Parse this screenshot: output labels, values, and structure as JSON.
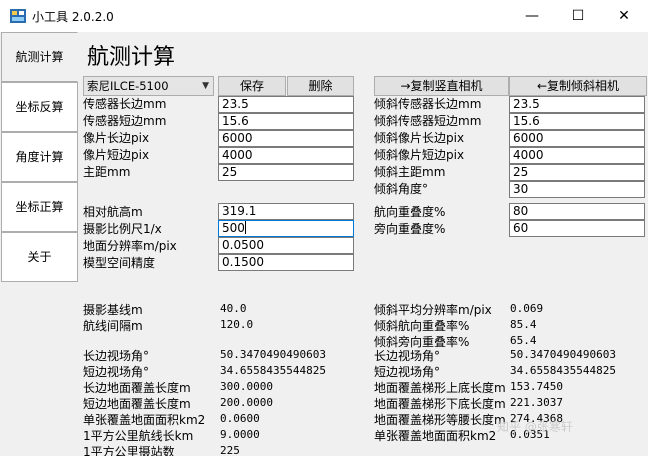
{
  "window": {
    "title": "小工具  2.0.2.0",
    "minimize_glyph": "—",
    "maximize_glyph": "☐",
    "close_glyph": "✕"
  },
  "nav": {
    "items": [
      {
        "label": "航测计算",
        "active": true
      },
      {
        "label": "坐标反算",
        "active": false
      },
      {
        "label": "角度计算",
        "active": false
      },
      {
        "label": "坐标正算",
        "active": false
      },
      {
        "label": "关于",
        "active": false
      }
    ]
  },
  "page": {
    "title": "航测计算",
    "camera_select": {
      "value": "索尼ILCE-5100"
    },
    "save_label": "保存",
    "delete_label": "删除",
    "copy_vertical_label": "→复制竖直相机",
    "copy_oblique_label": "←复制倾斜相机"
  },
  "vertical_camera": [
    {
      "label": "传感器长边mm",
      "value": "23.5"
    },
    {
      "label": "传感器短边mm",
      "value": "15.6"
    },
    {
      "label": "像片长边pix",
      "value": "6000"
    },
    {
      "label": "像片短边pix",
      "value": "4000"
    },
    {
      "label": "主距mm",
      "value": "25"
    }
  ],
  "oblique_camera": [
    {
      "label": "倾斜传感器长边mm",
      "value": "23.5"
    },
    {
      "label": "倾斜传感器短边mm",
      "value": "15.6"
    },
    {
      "label": "倾斜像片长边pix",
      "value": "6000"
    },
    {
      "label": "倾斜像片短边pix",
      "value": "4000"
    },
    {
      "label": "倾斜主距mm",
      "value": "25"
    },
    {
      "label": "倾斜角度°",
      "value": "30"
    }
  ],
  "flight_params": [
    {
      "label": "相对航高m",
      "value": "319.1"
    },
    {
      "label": "摄影比例尺1/x",
      "value": "500"
    },
    {
      "label": "地面分辨率m/pix",
      "value": "0.0500"
    },
    {
      "label": "模型空间精度",
      "value": "0.1500"
    }
  ],
  "overlap_params": [
    {
      "label": "航向重叠度%",
      "value": "80"
    },
    {
      "label": "旁向重叠度%",
      "value": "60"
    }
  ],
  "results_left": [
    {
      "label": "摄影基线m",
      "value": "40.0"
    },
    {
      "label": "航线间隔m",
      "value": "120.0"
    },
    {
      "label": "长边视场角°",
      "value": "50.3470490490603"
    },
    {
      "label": "短边视场角°",
      "value": "34.6558435544825"
    },
    {
      "label": "长边地面覆盖长度m",
      "value": "300.0000"
    },
    {
      "label": "短边地面覆盖长度m",
      "value": "200.0000"
    },
    {
      "label": "单张覆盖地面面积km2",
      "value": "0.0600"
    },
    {
      "label": "1平方公里航线长km",
      "value": "9.0000"
    },
    {
      "label": "1平方公里摄站数",
      "value": "225"
    }
  ],
  "results_right": [
    {
      "label": "倾斜平均分辨率m/pix",
      "value": "0.069"
    },
    {
      "label": "倾斜航向重叠率%",
      "value": "85.4"
    },
    {
      "label": "倾斜旁向重叠率%",
      "value": "65.4"
    },
    {
      "label": "长边视场角°",
      "value": "50.3470490490603"
    },
    {
      "label": "短边视场角°",
      "value": "34.6558435544825"
    },
    {
      "label": "地面覆盖梯形上底长度m",
      "value": "153.7450"
    },
    {
      "label": "地面覆盖梯形下底长度m",
      "value": "221.3037"
    },
    {
      "label": "地面覆盖梯形等腰长度m",
      "value": "274.4368"
    },
    {
      "label": "单张覆盖地面面积km2",
      "value": "0.0351"
    }
  ],
  "watermark": "知乎 @张寒轩",
  "colors": {
    "focus_border": "#0078d7",
    "window_bg": "#f0f0f0"
  }
}
